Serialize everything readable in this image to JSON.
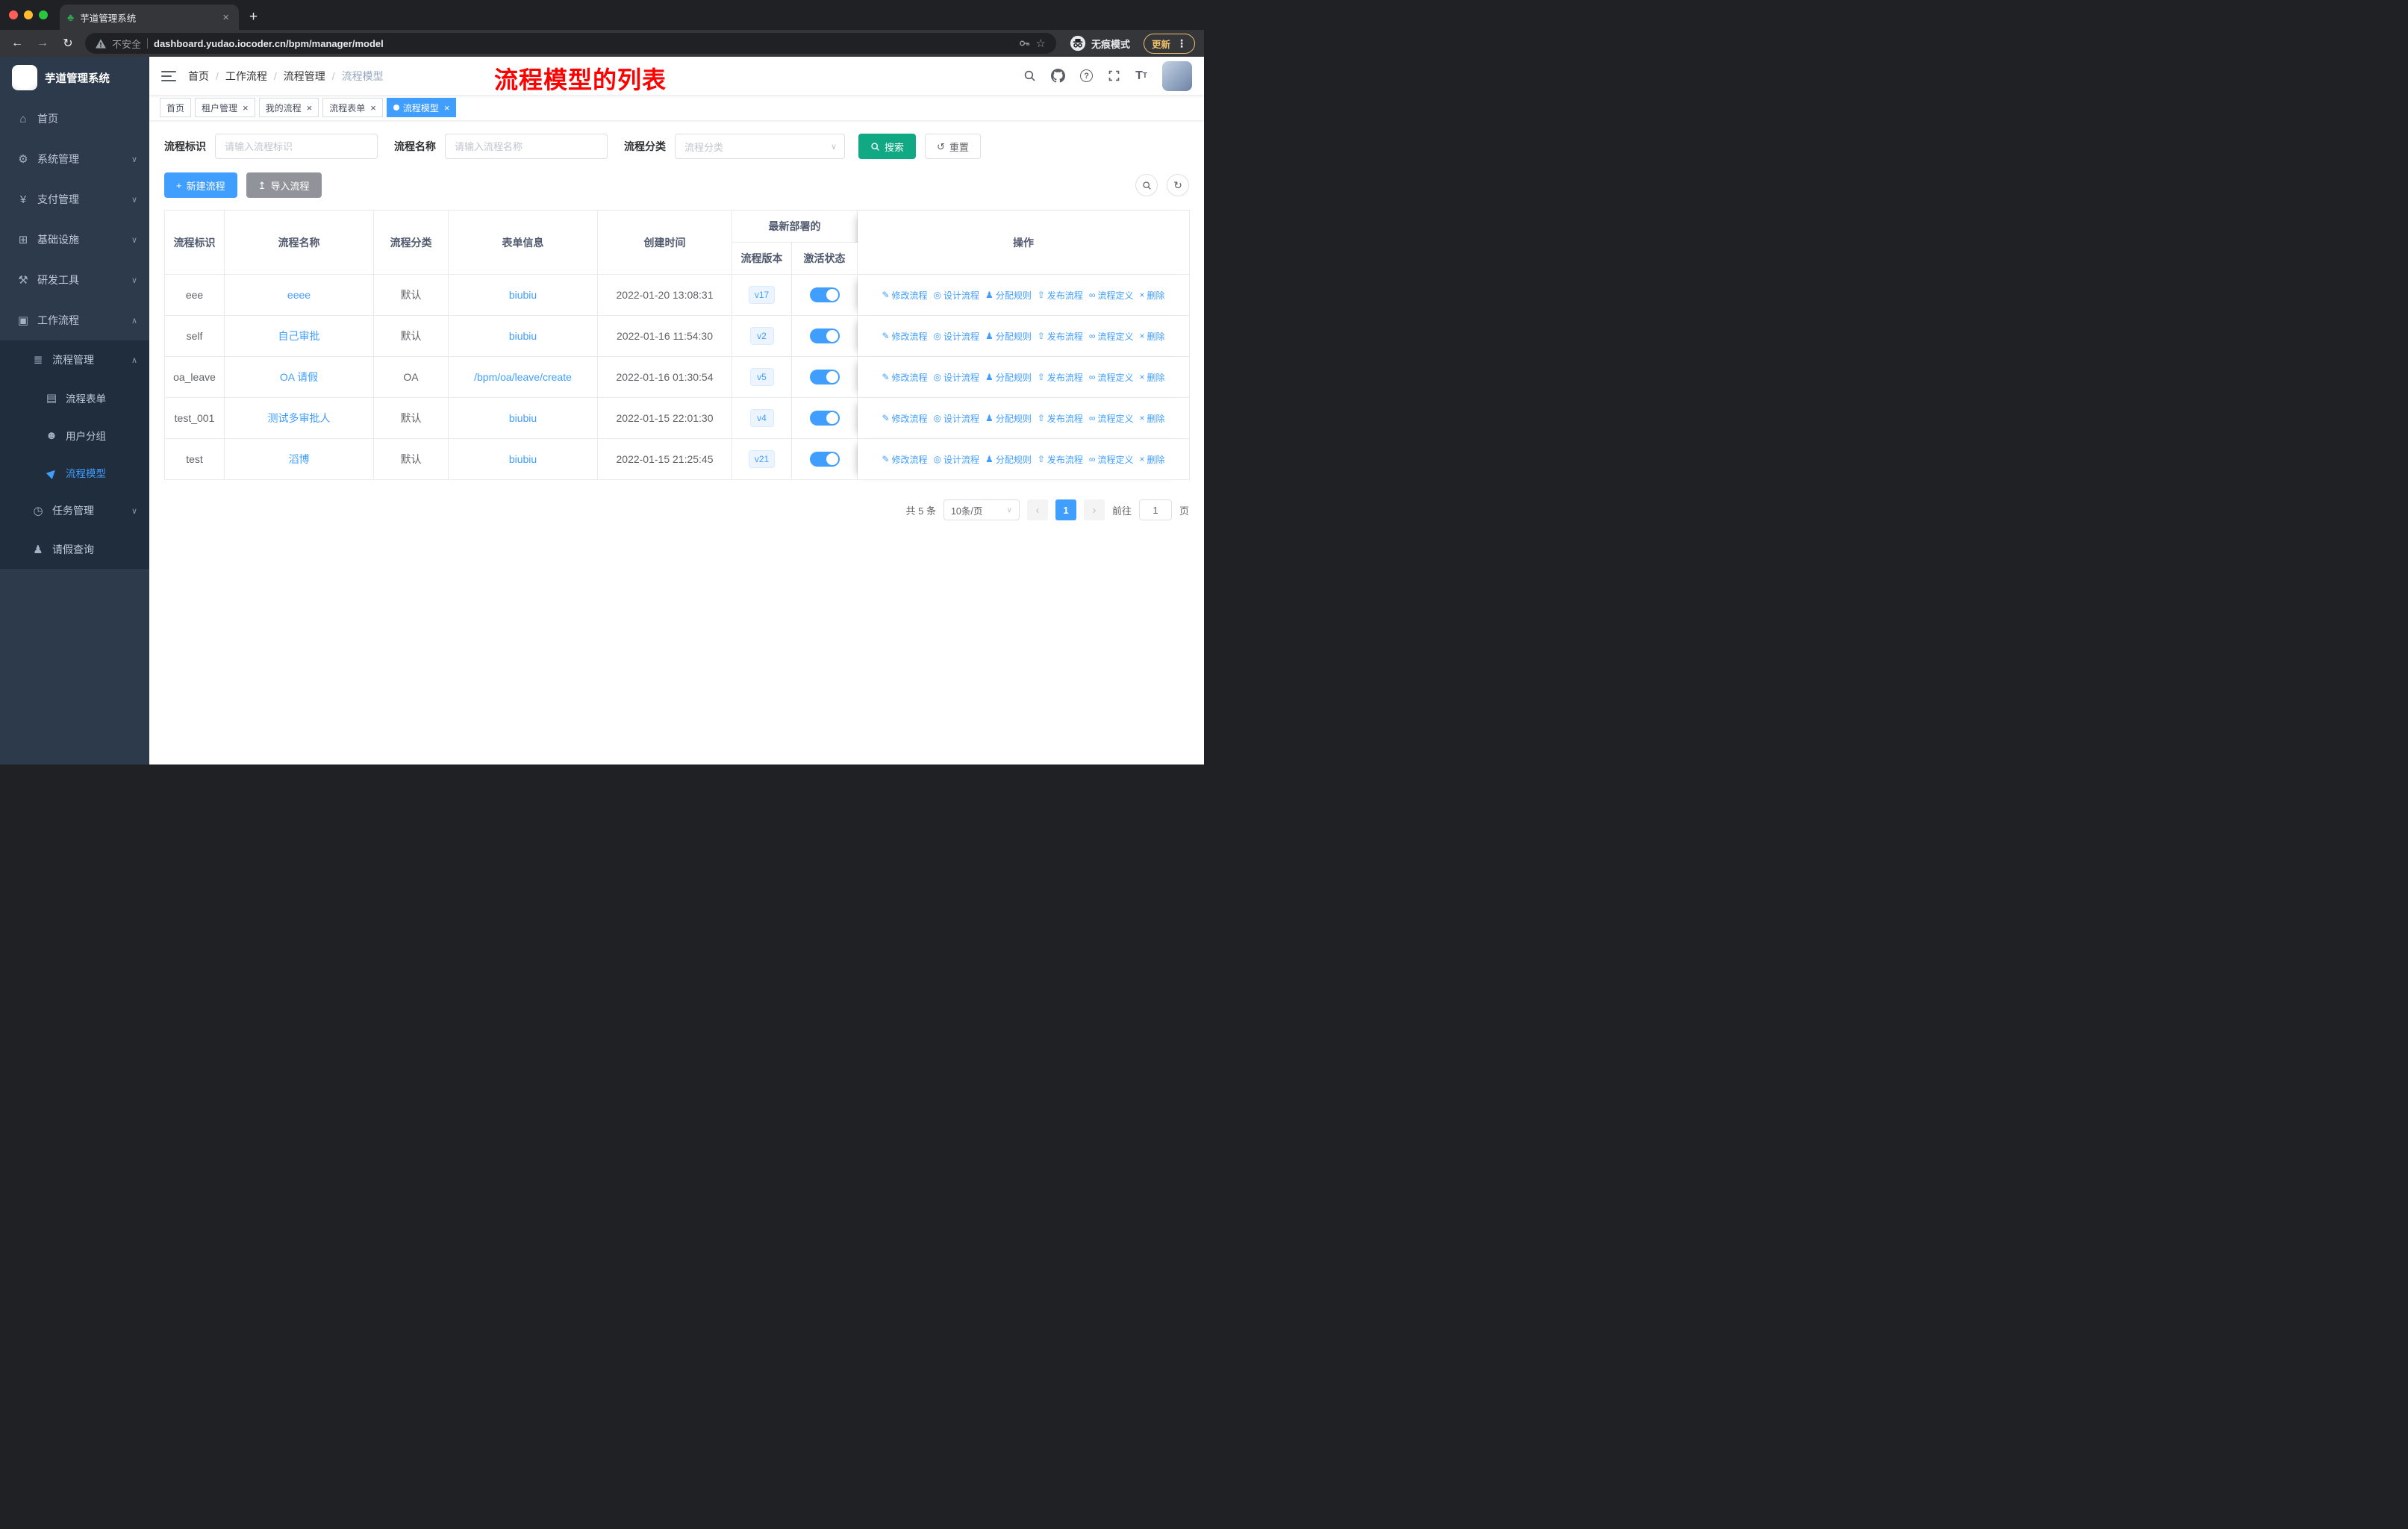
{
  "browser": {
    "tab_title": "芋道管理系统",
    "security_label": "不安全",
    "url": "dashboard.yudao.iocoder.cn/bpm/manager/model",
    "incognito_label": "无痕模式",
    "update_label": "更新"
  },
  "sidebar": {
    "logo_title": "芋道管理系统",
    "top_items": [
      {
        "label": "首页",
        "icon": "home-icon",
        "level": 1
      },
      {
        "label": "系统管理",
        "icon": "gear-icon",
        "level": 1,
        "chevron": "down"
      },
      {
        "label": "支付管理",
        "icon": "payment-icon",
        "level": 1,
        "chevron": "down"
      },
      {
        "label": "基础设施",
        "icon": "infrastructure-icon",
        "level": 1,
        "chevron": "down"
      },
      {
        "label": "研发工具",
        "icon": "tools-icon",
        "level": 1,
        "chevron": "down"
      },
      {
        "label": "工作流程",
        "icon": "workflow-icon",
        "level": 1,
        "chevron": "up"
      }
    ],
    "workflow_submenu": [
      {
        "label": "流程管理",
        "icon": "process-management-icon",
        "level": 2,
        "chevron": "up"
      },
      {
        "label": "流程表单",
        "icon": "process-form-icon",
        "level": 3
      },
      {
        "label": "用户分组",
        "icon": "user-group-icon",
        "level": 3
      },
      {
        "label": "流程模型",
        "icon": "process-model-icon",
        "level": 3,
        "active": true
      },
      {
        "label": "任务管理",
        "icon": "task-management-icon",
        "level": 2,
        "chevron": "down"
      },
      {
        "label": "请假查询",
        "icon": "leave-query-icon",
        "level": 2
      }
    ]
  },
  "header": {
    "breadcrumb": [
      "首页",
      "工作流程",
      "流程管理",
      "流程模型"
    ],
    "annotation": "流程模型的列表"
  },
  "tags": [
    {
      "label": "首页",
      "closable": false,
      "active": false
    },
    {
      "label": "租户管理",
      "closable": true,
      "active": false
    },
    {
      "label": "我的流程",
      "closable": true,
      "active": false
    },
    {
      "label": "流程表单",
      "closable": true,
      "active": false
    },
    {
      "label": "流程模型",
      "closable": true,
      "active": true
    }
  ],
  "filters": {
    "process_key_label": "流程标识",
    "process_key_placeholder": "请输入流程标识",
    "process_name_label": "流程名称",
    "process_name_placeholder": "请输入流程名称",
    "category_label": "流程分类",
    "category_placeholder": "流程分类",
    "search_button": "搜索",
    "reset_button": "重置"
  },
  "toolbar": {
    "create_button": "新建流程",
    "import_button": "导入流程"
  },
  "table": {
    "columns": [
      "流程标识",
      "流程名称",
      "流程分类",
      "表单信息",
      "创建时间",
      "流程版本",
      "激活状态",
      "操作"
    ],
    "group_header": "最新部署的",
    "operations": [
      "修改流程",
      "设计流程",
      "分配规则",
      "发布流程",
      "流程定义",
      "删除"
    ],
    "rows": [
      {
        "key": "eee",
        "name": "eeee",
        "category": "默认",
        "form": "biubiu",
        "created": "2022-01-20 13:08:31",
        "version": "v17",
        "active": true
      },
      {
        "key": "self",
        "name": "自己审批",
        "category": "默认",
        "form": "biubiu",
        "created": "2022-01-16 11:54:30",
        "version": "v2",
        "active": true
      },
      {
        "key": "oa_leave",
        "name": "OA 请假",
        "category": "OA",
        "form": "/bpm/oa/leave/create",
        "created": "2022-01-16 01:30:54",
        "version": "v5",
        "active": true
      },
      {
        "key": "test_001",
        "name": "测试多审批人",
        "category": "默认",
        "form": "biubiu",
        "created": "2022-01-15 22:01:30",
        "version": "v4",
        "active": true
      },
      {
        "key": "test",
        "name": "滔博",
        "category": "默认",
        "form": "biubiu",
        "created": "2022-01-15 21:25:45",
        "version": "v21",
        "active": true
      }
    ]
  },
  "pagination": {
    "total": "共 5 条",
    "page_size": "10条/页",
    "current_page": "1",
    "goto_label": "前往",
    "goto_value": "1",
    "page_label": "页"
  },
  "colors": {
    "primary": "#409eff",
    "search_button": "#11a983",
    "sidebar_bg": "#2d3a4b",
    "submenu_bg": "#1f2d3d",
    "annotation": "#ff0000"
  }
}
